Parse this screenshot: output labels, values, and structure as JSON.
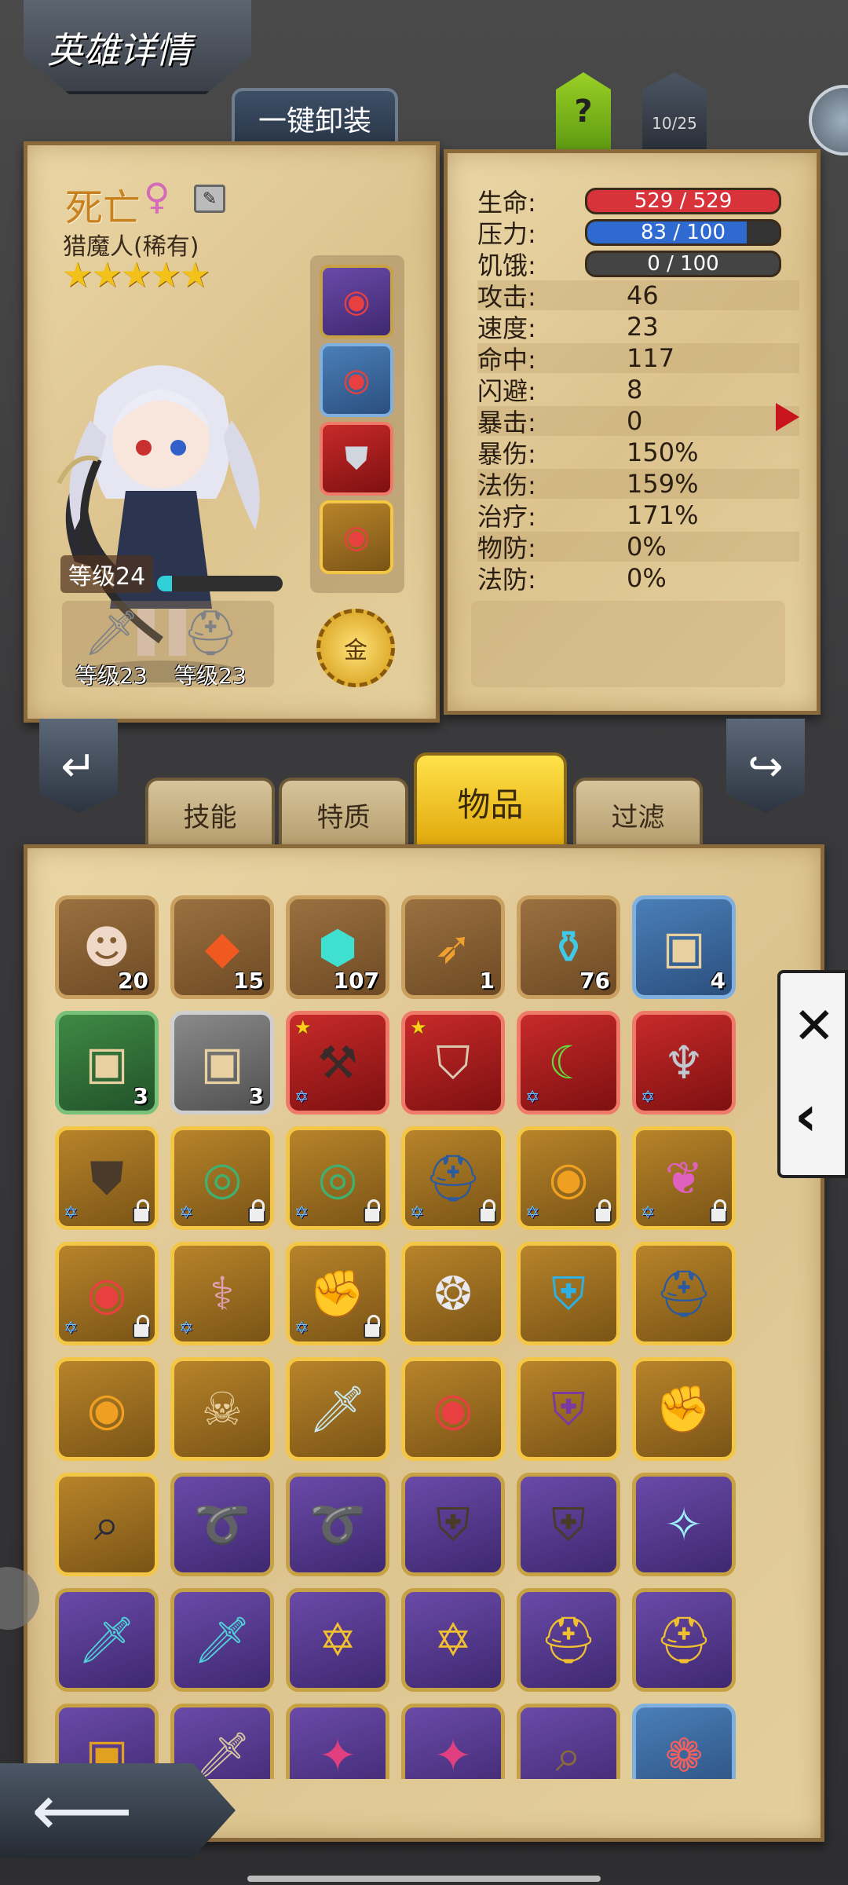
{
  "header": {
    "title": "英雄详情",
    "unequip_all_label": "一键卸装",
    "help_label": "?",
    "roster_count": "10/25"
  },
  "hero": {
    "name": "死亡",
    "gender_icon": "female-icon",
    "class": "猎魔人(稀有)",
    "stars": "★★★★★",
    "level_label": "等级24",
    "xp_fraction": 0.12,
    "weapon_level": "等级23",
    "armor_level": "等级23",
    "gold_label": "金"
  },
  "stats": {
    "hp_label": "生命:",
    "hp_value": "529 / 529",
    "hp_fraction": 1.0,
    "stress_label": "压力:",
    "stress_value": "83 / 100",
    "stress_fraction": 0.83,
    "hunger_label": "饥饿:",
    "hunger_value": "0 / 100",
    "hunger_fraction": 0.0,
    "rows": [
      {
        "label": "攻击:",
        "value": "46"
      },
      {
        "label": "速度:",
        "value": "23"
      },
      {
        "label": "命中:",
        "value": "117"
      },
      {
        "label": "闪避:",
        "value": "8"
      },
      {
        "label": "暴击:",
        "value": "0"
      },
      {
        "label": "暴伤:",
        "value": "150%"
      },
      {
        "label": "法伤:",
        "value": "159%"
      },
      {
        "label": "治疗:",
        "value": "171%"
      },
      {
        "label": "物防:",
        "value": "0%"
      },
      {
        "label": "法防:",
        "value": "0%"
      }
    ]
  },
  "tabs": {
    "skills": "技能",
    "traits": "特质",
    "items": "物品",
    "filter": "过滤"
  },
  "inventory": [
    {
      "icon": "hero-portrait-icon",
      "count": "20"
    },
    {
      "icon": "fire-crystal-icon",
      "count": "15"
    },
    {
      "icon": "teal-gem-icon",
      "count": "107"
    },
    {
      "icon": "feather-icon",
      "count": "1"
    },
    {
      "icon": "potion-icon",
      "count": "76"
    },
    {
      "icon": "blue-chest-icon",
      "count": "4"
    },
    {
      "icon": "green-chest-icon",
      "count": "3"
    },
    {
      "icon": "gray-chest-icon",
      "count": "3"
    }
  ],
  "colors": {
    "hp": "#d8323a",
    "stress": "#2f6ad0",
    "hunger": "#444444",
    "xp": "#30d0d8",
    "accent_gold": "#f2c21a"
  }
}
